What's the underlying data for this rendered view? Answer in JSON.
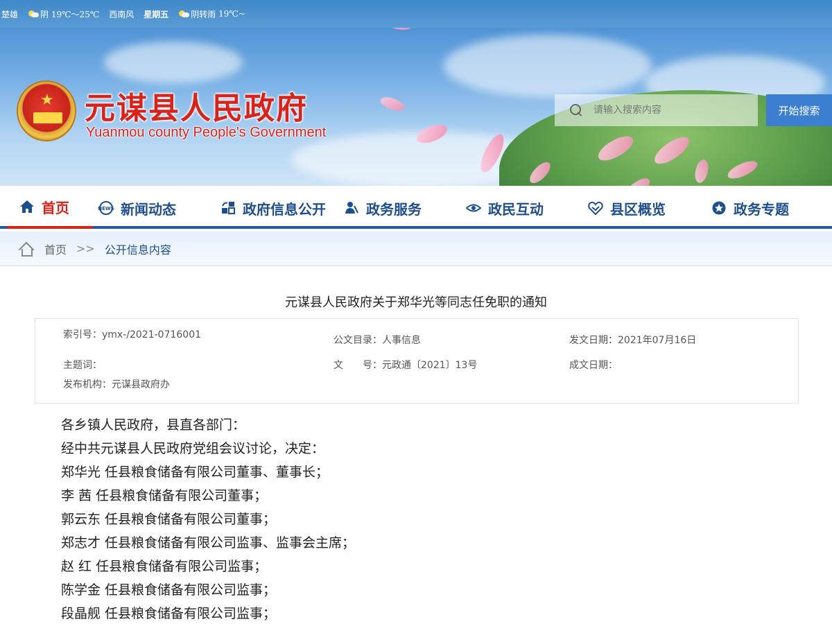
{
  "weather": {
    "city": "楚雄",
    "today_condition": "阴",
    "today_temp": "19℃～25℃",
    "wind": "西南风",
    "weekday": "星期五",
    "tomorrow_condition": "阴转雨",
    "tomorrow_temp": "19℃~"
  },
  "header": {
    "title": "元谋县人民政府",
    "subtitle": "Yuanmou county People's Government",
    "search_placeholder": "请输入搜索内容",
    "search_button": "开始搜索"
  },
  "nav": {
    "items": [
      {
        "label": "首页",
        "icon": "home-icon"
      },
      {
        "label": "新闻动态",
        "icon": "news-icon"
      },
      {
        "label": "政府信息公开",
        "icon": "info-icon"
      },
      {
        "label": "政务服务",
        "icon": "service-icon"
      },
      {
        "label": "政民互动",
        "icon": "eye-icon"
      },
      {
        "label": "县区概览",
        "icon": "handshake-icon"
      },
      {
        "label": "政务专题",
        "icon": "star-icon"
      }
    ]
  },
  "breadcrumb": {
    "home": "首页",
    "separator": ">>",
    "current": "公开信息内容"
  },
  "article": {
    "title": "元谋县人民政府关于郑华光等同志任免职的通知",
    "meta": {
      "index_label": "索引号：",
      "index_value": "ymx-/2021-0716001",
      "catalog_label": "公文目录：",
      "catalog_value": "人事信息",
      "date_label": "发文日期：",
      "date_value": "2021年07月16日",
      "subject_label": "主题词：",
      "subject_value": "",
      "doc_no_label": "文　　号：",
      "doc_no_value": "元政通〔2021〕13号",
      "created_label": "成文日期：",
      "created_value": "",
      "publisher_label": "发布机构：",
      "publisher_value": "元谋县政府办"
    },
    "paragraphs": [
      "各乡镇人民政府，县直各部门：",
      "经中共元谋县人民政府党组会议讨论，决定：",
      "郑华光  任县粮食储备有限公司董事、董事长；",
      "李  茜  任县粮食储备有限公司董事；",
      "郭云东  任县粮食储备有限公司董事；",
      "郑志才  任县粮食储备有限公司监事、监事会主席；",
      "赵  红  任县粮食储备有限公司监事；",
      "陈学金  任县粮食储备有限公司监事；",
      "段晶舰  任县粮食储备有限公司监事；"
    ]
  },
  "colors": {
    "brand_red": "#d8231b",
    "nav_blue": "#1f4e8c",
    "search_button": "#3c7fd0"
  }
}
